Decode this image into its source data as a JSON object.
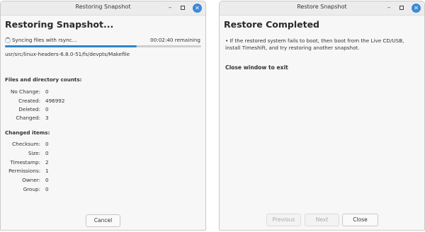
{
  "left_window": {
    "title": "Restoring Snapshot",
    "heading": "Restoring Snapshot...",
    "status_text": "Syncing files with rsync...",
    "time_remaining": "00:02:40 remaining",
    "progress": 0.67,
    "current_file": "usr/src/linux-headers-6.8.0-51/fs/devpts/Makefile",
    "counts_heading": "Files and directory counts:",
    "counts": [
      {
        "label": "No Change:",
        "value": "0"
      },
      {
        "label": "Created:",
        "value": "496992"
      },
      {
        "label": "Deleted:",
        "value": "0"
      },
      {
        "label": "Changed:",
        "value": "3"
      }
    ],
    "changed_heading": "Changed items:",
    "changed": [
      {
        "label": "Checksum:",
        "value": "0"
      },
      {
        "label": "Size:",
        "value": "0"
      },
      {
        "label": "Timestamp:",
        "value": "2"
      },
      {
        "label": "Permissions:",
        "value": "1"
      },
      {
        "label": "Owner:",
        "value": "0"
      },
      {
        "label": "Group:",
        "value": "0"
      }
    ],
    "cancel_label": "Cancel"
  },
  "right_window": {
    "title": "Restore Snapshot",
    "heading": "Restore Completed",
    "message": "• If the restored system fails to boot, then boot from the Live CD/USB, install Timeshift, and try restoring another snapshot.",
    "close_hint": "Close window to exit",
    "previous_label": "Previous",
    "next_label": "Next",
    "close_label": "Close"
  },
  "window_controls": {
    "minimize": "–",
    "close": "✕"
  },
  "colors": {
    "accent": "#2f86c9",
    "close_button": "#3b8ad8"
  }
}
